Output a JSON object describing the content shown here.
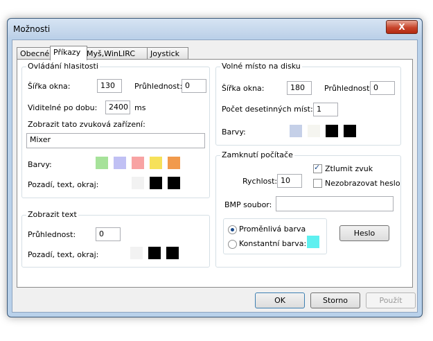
{
  "window": {
    "title": "Možnosti",
    "close_label": "X"
  },
  "tabs": [
    {
      "label": "Obecné"
    },
    {
      "label": "Příkazy"
    },
    {
      "label": "Myš,WinLIRC"
    },
    {
      "label": "Joystick"
    }
  ],
  "volume": {
    "legend": "Ovládání hlasitosti",
    "width_label": "Šířka okna:",
    "width_value": "130",
    "opacity_label": "Průhlednost:",
    "opacity_value": "0",
    "visible_label": "Viditelné po dobu:",
    "visible_value": "2400",
    "visible_unit": "ms",
    "devices_label": "Zobrazit tato zvuková zařízení:",
    "devices_value": "Mixer",
    "colors_label": "Barvy:",
    "colors": [
      "#a6e29a",
      "#c0c0f4",
      "#f8a3a3",
      "#f6e15a",
      "#f19a4c"
    ],
    "bg_label": "Pozadí, text, okraj:",
    "bg_colors": [
      "#f2f2f2",
      "#000000",
      "#000000"
    ]
  },
  "text": {
    "legend": "Zobrazit text",
    "opacity_label": "Průhlednost:",
    "opacity_value": "0",
    "bg_label": "Pozadí, text, okraj:",
    "bg_colors": [
      "#f2f2f2",
      "#000000",
      "#000000"
    ]
  },
  "disk": {
    "legend": "Volné místo na disku",
    "width_label": "Šířka okna:",
    "width_value": "180",
    "opacity_label": "Průhlednost:",
    "opacity_value": "0",
    "decimals_label": "Počet desetinných míst:",
    "decimals_value": "1",
    "colors_label": "Barvy:",
    "colors": [
      "#c5d0e8",
      "#f5f5f0",
      "#000000",
      "#000000"
    ]
  },
  "lock": {
    "legend": "Zamknutí počítače",
    "speed_label": "Rychlost:",
    "speed_value": "10",
    "mute_label": "Ztlumit zvuk",
    "hide_pw_label": "Nezobrazovat heslo",
    "bmp_label": "BMP soubor:",
    "bmp_value": "",
    "variable_label": "Proměnlivá barva",
    "constant_label": "Konstantní barva:",
    "constant_color": "#5ef0f0",
    "password_button": "Heslo"
  },
  "footer": {
    "ok": "OK",
    "cancel": "Storno",
    "apply": "Použít"
  }
}
